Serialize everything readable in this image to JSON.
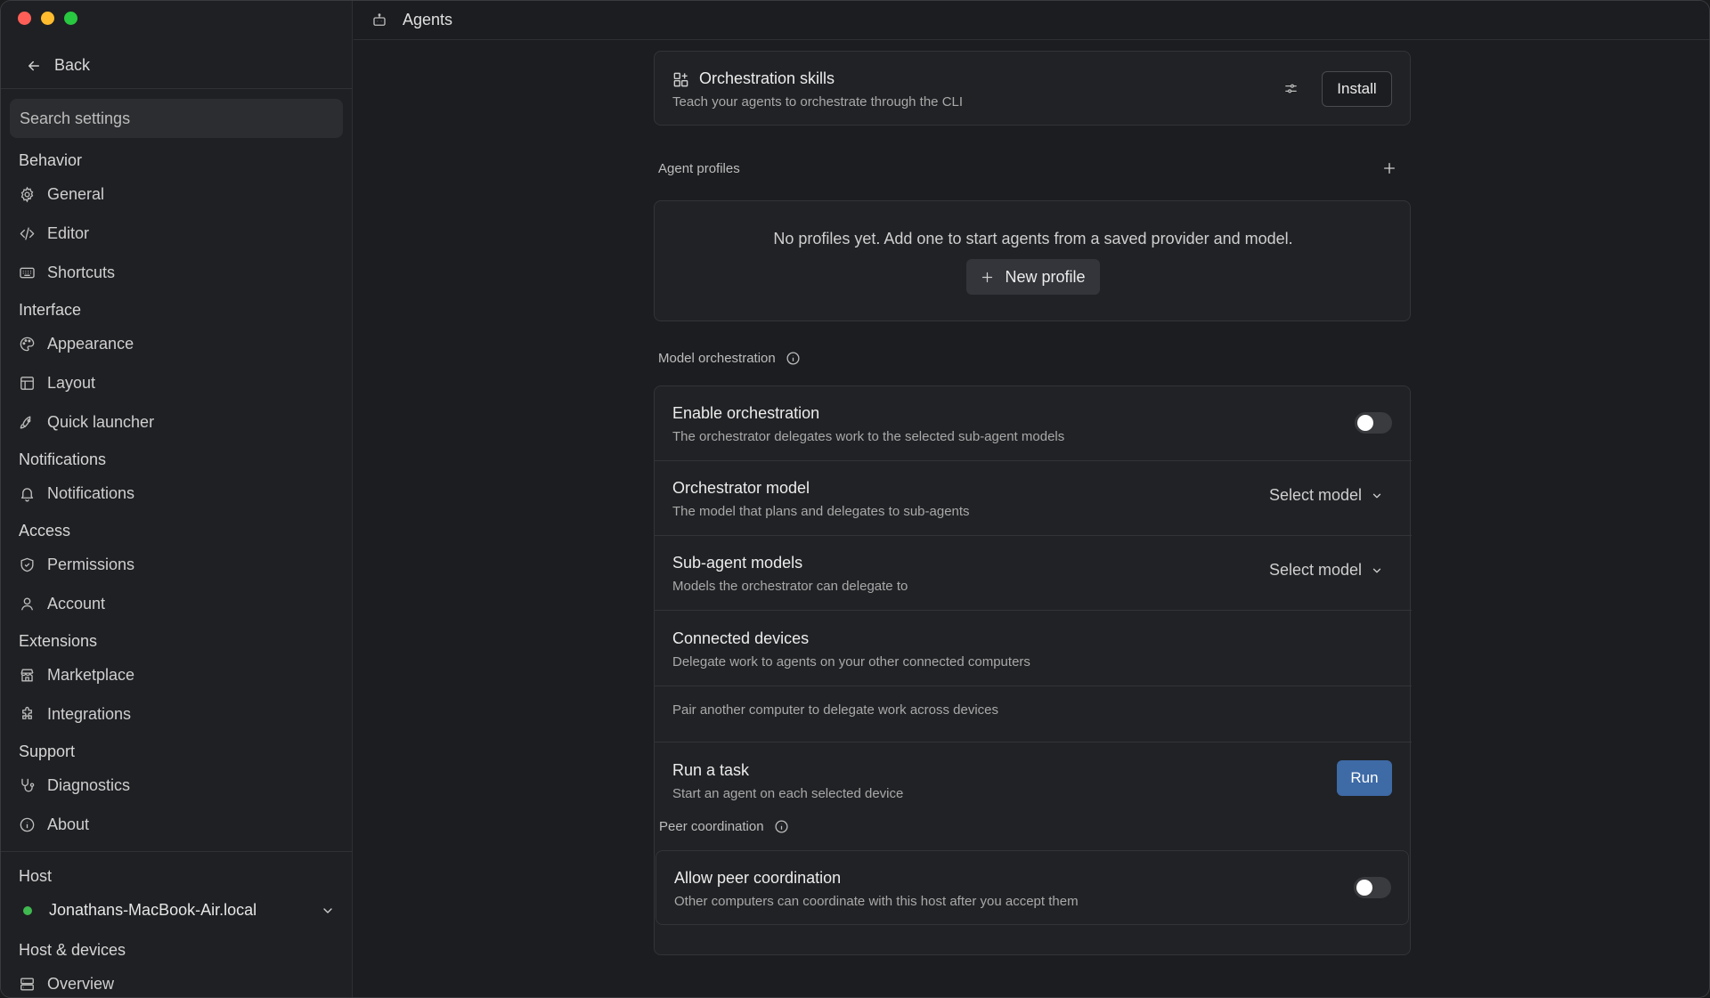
{
  "sidebar": {
    "back_label": "Back",
    "search_placeholder": "Search settings",
    "sections": {
      "behavior": "Behavior",
      "interface": "Interface",
      "notifications": "Notifications",
      "access": "Access",
      "extensions": "Extensions",
      "support": "Support",
      "host": "Host",
      "host_devices": "Host & devices"
    },
    "items": {
      "general": "General",
      "editor": "Editor",
      "shortcuts": "Shortcuts",
      "appearance": "Appearance",
      "layout": "Layout",
      "quick_launcher": "Quick launcher",
      "notifications": "Notifications",
      "permissions": "Permissions",
      "account": "Account",
      "marketplace": "Marketplace",
      "integrations": "Integrations",
      "diagnostics": "Diagnostics",
      "about": "About",
      "overview": "Overview"
    },
    "host_name": "Jonathans-MacBook-Air.local",
    "host_status_color": "#3fb950"
  },
  "header": {
    "title": "Agents"
  },
  "main": {
    "orchestration_skills": {
      "title": "Orchestration skills",
      "subtitle": "Teach your agents to orchestrate through the CLI",
      "install_label": "Install"
    },
    "agent_profiles": {
      "label": "Agent profiles",
      "empty_text": "No profiles yet. Add one to start agents from a saved provider and model.",
      "new_profile_label": "New profile"
    },
    "model_orchestration": {
      "label": "Model orchestration",
      "enable": {
        "title": "Enable orchestration",
        "subtitle": "The orchestrator delegates work to the selected sub-agent models",
        "enabled": false
      },
      "orchestrator_model": {
        "title": "Orchestrator model",
        "subtitle": "The model that plans and delegates to sub-agents",
        "select_label": "Select model"
      },
      "sub_agent_models": {
        "title": "Sub-agent models",
        "subtitle": "Models the orchestrator can delegate to",
        "select_label": "Select model"
      },
      "connected_devices": {
        "title": "Connected devices",
        "subtitle": "Delegate work to agents on your other connected computers",
        "pair_text": "Pair another computer to delegate work across devices"
      },
      "run_task": {
        "title": "Run a task",
        "subtitle": "Start an agent on each selected device",
        "run_label": "Run"
      }
    },
    "peer_coordination": {
      "label": "Peer coordination",
      "allow": {
        "title": "Allow peer coordination",
        "subtitle": "Other computers can coordinate with this host after you accept them",
        "enabled": false
      }
    }
  },
  "colors": {
    "accent": "#3e6aa6",
    "background": "#1c1d20"
  }
}
